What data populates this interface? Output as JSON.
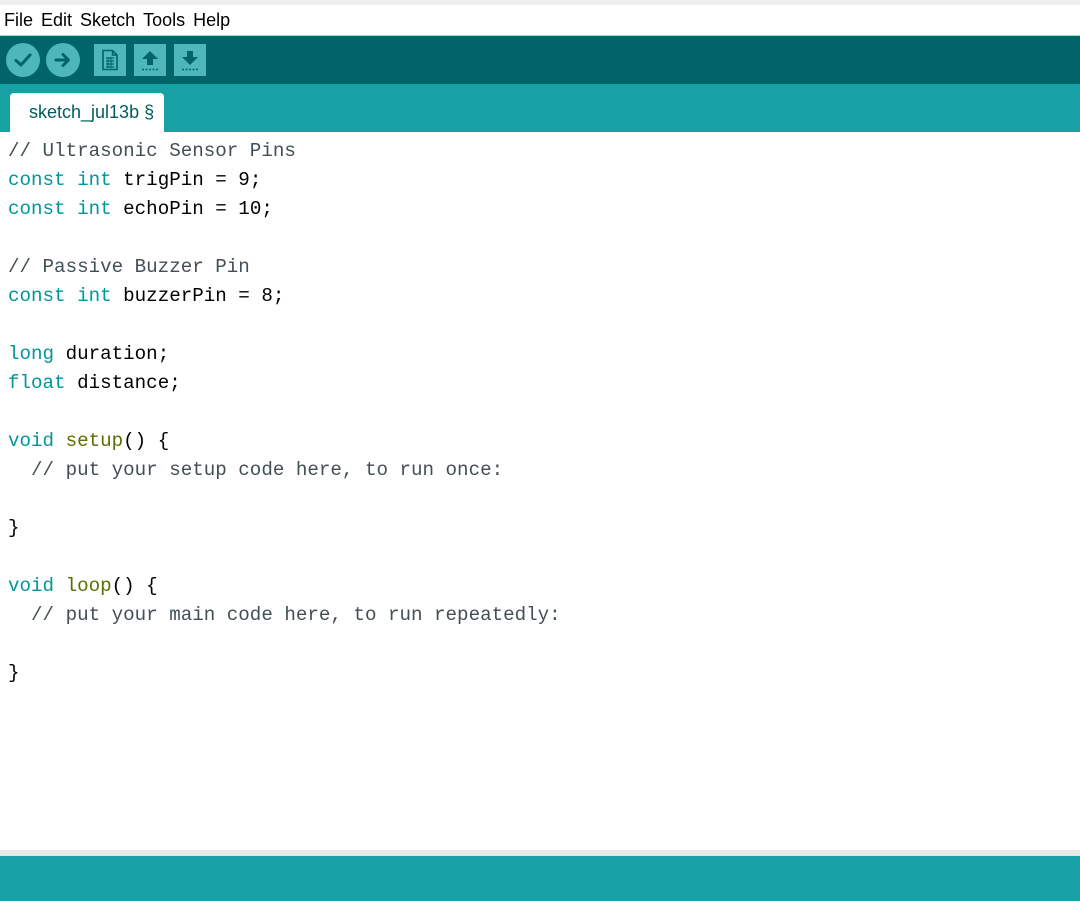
{
  "menu": [
    "File",
    "Edit",
    "Sketch",
    "Tools",
    "Help"
  ],
  "toolbar": {
    "buttons": [
      {
        "name": "verify-button",
        "icon": "check-icon"
      },
      {
        "name": "upload-button",
        "icon": "arrow-right-icon"
      },
      {
        "name": "new-button",
        "icon": "new-file-icon"
      },
      {
        "name": "open-button",
        "icon": "arrow-up-icon"
      },
      {
        "name": "save-button",
        "icon": "arrow-down-icon"
      }
    ]
  },
  "tab": {
    "label": "sketch_jul13b §"
  },
  "code": {
    "lines": [
      [
        {
          "t": "// Ultrasonic Sensor Pins",
          "c": "cmt"
        }
      ],
      [
        {
          "t": "const",
          "c": "kw"
        },
        {
          "t": " ",
          "c": "plain"
        },
        {
          "t": "int",
          "c": "kw"
        },
        {
          "t": " trigPin = 9;",
          "c": "plain"
        }
      ],
      [
        {
          "t": "const",
          "c": "kw"
        },
        {
          "t": " ",
          "c": "plain"
        },
        {
          "t": "int",
          "c": "kw"
        },
        {
          "t": " echoPin = 10;",
          "c": "plain"
        }
      ],
      [],
      [
        {
          "t": "// Passive Buzzer Pin",
          "c": "cmt"
        }
      ],
      [
        {
          "t": "const",
          "c": "kw"
        },
        {
          "t": " ",
          "c": "plain"
        },
        {
          "t": "int",
          "c": "kw"
        },
        {
          "t": " buzzerPin = 8;",
          "c": "plain"
        }
      ],
      [],
      [
        {
          "t": "long",
          "c": "kw"
        },
        {
          "t": " duration;",
          "c": "plain"
        }
      ],
      [
        {
          "t": "float",
          "c": "kw"
        },
        {
          "t": " distance;",
          "c": "plain"
        }
      ],
      [],
      [
        {
          "t": "void",
          "c": "kw"
        },
        {
          "t": " ",
          "c": "plain"
        },
        {
          "t": "setup",
          "c": "fn"
        },
        {
          "t": "() {",
          "c": "plain"
        }
      ],
      [
        {
          "t": "  // put your setup code here, to run once:",
          "c": "cmt"
        }
      ],
      [],
      [
        {
          "t": "}",
          "c": "plain"
        }
      ],
      [],
      [
        {
          "t": "void",
          "c": "kw"
        },
        {
          "t": " ",
          "c": "plain"
        },
        {
          "t": "loop",
          "c": "fn"
        },
        {
          "t": "() {",
          "c": "plain"
        }
      ],
      [
        {
          "t": "  // put your main code here, to run repeatedly:",
          "c": "cmt"
        }
      ],
      [],
      [
        {
          "t": "}",
          "c": "plain"
        }
      ]
    ]
  },
  "colors": {
    "toolbar_bg": "#006468",
    "tab_bar_bg": "#17a1a5",
    "button_bg": "#4db7bb",
    "keyword": "#00979c",
    "function": "#5e6d03",
    "comment": "#434f54"
  }
}
